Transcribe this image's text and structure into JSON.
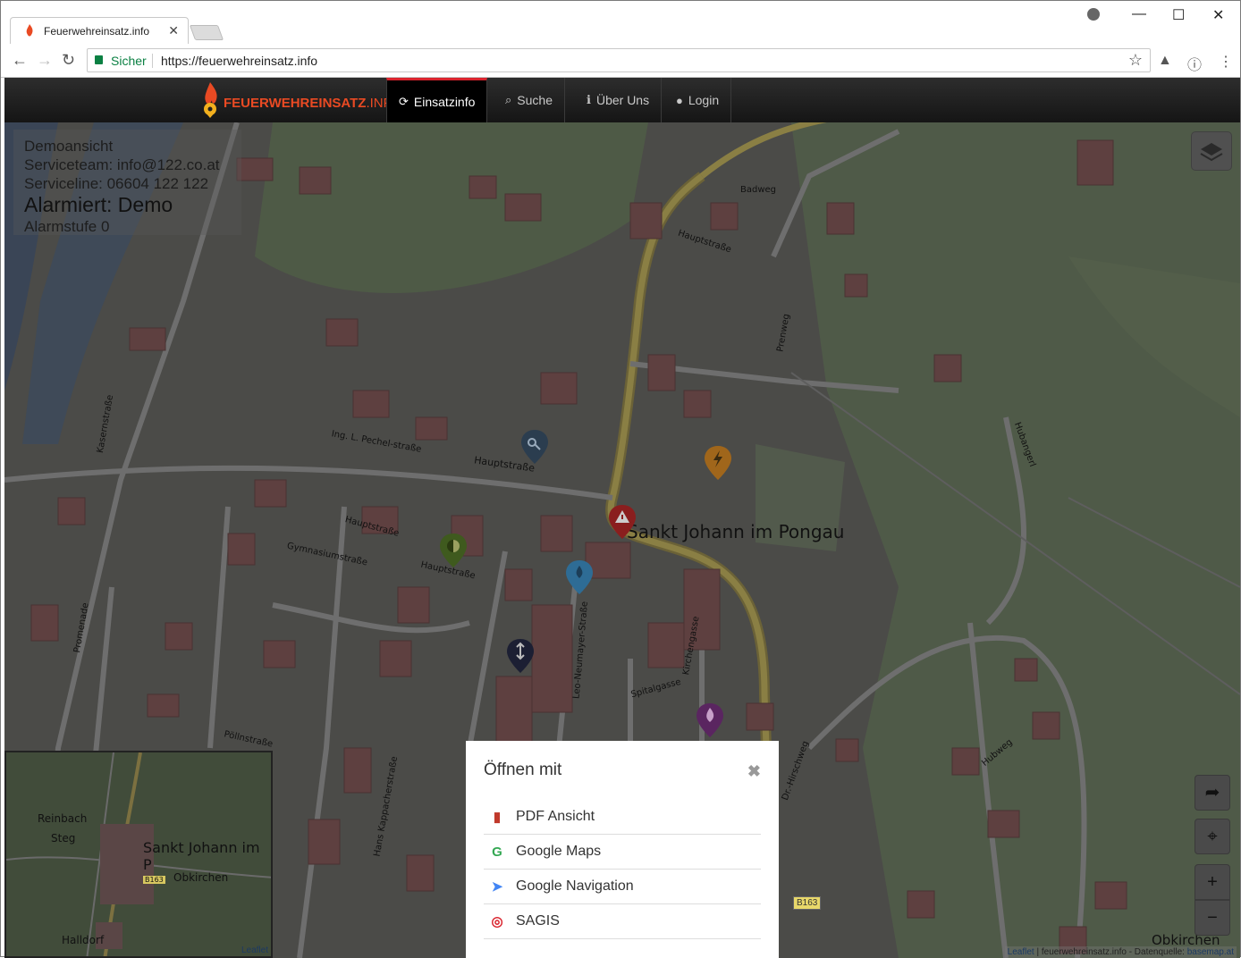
{
  "browser": {
    "tab_title": "Feuerwehreinsatz.info",
    "secure_label": "Sicher",
    "url": "https://feuerwehreinsatz.info"
  },
  "app": {
    "logo_main": "FEUERWEHREINSATZ",
    "logo_suffix": ".INFO",
    "nav": [
      {
        "label": "Einsatzinfo",
        "icon": "refresh-icon"
      },
      {
        "label": "Suche",
        "icon": "search-icon"
      },
      {
        "label": "Über Uns",
        "icon": "info-icon"
      },
      {
        "label": "Login",
        "icon": "user-icon"
      }
    ]
  },
  "info": {
    "line1": "Demoansicht",
    "line2": "Serviceteam: info@122.co.at",
    "line3": "Serviceline: 06604 122 122",
    "alarm": "Alarmiert: Demo",
    "level": "Alarmstufe 0"
  },
  "map": {
    "town": "Sankt Johann im Pongau",
    "streets": [
      "Hauptstraße",
      "Badweg",
      "Hubangerl",
      "Pöllnstraße",
      "Hubweg",
      "Spitalgasse",
      "Kirchengasse",
      "Leo-Neumayer-Straße",
      "Ing. L. Pechel-straße",
      "Gymnasiumstraße",
      "Kasernstraße",
      "Hans Kappacherstraße",
      "Promenade",
      "Dr.-Hirschweg",
      "Prenweg"
    ],
    "road_badge": "B163",
    "corner_place": "Obkirchen",
    "attribution_leaflet": "Leaflet",
    "attribution_text": " | feuerwehreinsatz.info - Datenquelle: ",
    "attribution_source": "basemap.at"
  },
  "minimap": {
    "labels": [
      "Reinbach",
      "Steg",
      "Sankt Johann im P",
      "Obkirchen",
      "Halldorf",
      "B163"
    ],
    "attribution": "Leaflet"
  },
  "popup": {
    "title": "Öffnen mit",
    "items": [
      {
        "label": "PDF Ansicht",
        "icon": "file-icon",
        "color": "#c0392b"
      },
      {
        "label": "Google Maps",
        "icon": "google-icon",
        "color": "#34a853"
      },
      {
        "label": "Google Navigation",
        "icon": "navigation-arrow-icon",
        "color": "#4285f4"
      },
      {
        "label": "SAGIS",
        "icon": "target-icon",
        "color": "#d9232d"
      }
    ]
  },
  "colors": {
    "accent": "#d9232d",
    "logo": "#e94a23"
  }
}
